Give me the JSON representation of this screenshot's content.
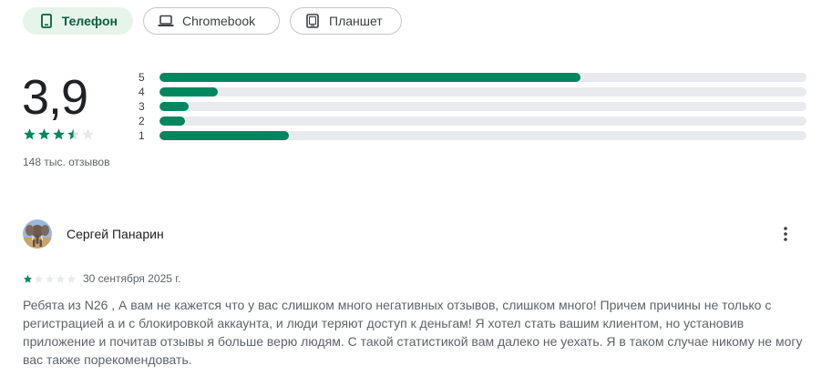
{
  "device_tabs": [
    {
      "label": "Телефон",
      "icon": "phone-icon",
      "active": true
    },
    {
      "label": "Chromebook",
      "icon": "laptop-icon",
      "active": false
    },
    {
      "label": "Планшет",
      "icon": "tablet-icon",
      "active": false
    }
  ],
  "summary": {
    "rating": "3,9",
    "stars": 3.5,
    "reviews_count": "148 тыс. отзывов"
  },
  "histogram": [
    {
      "label": "5",
      "fraction": 0.65
    },
    {
      "label": "4",
      "fraction": 0.09
    },
    {
      "label": "3",
      "fraction": 0.045
    },
    {
      "label": "2",
      "fraction": 0.04
    },
    {
      "label": "1",
      "fraction": 0.2
    }
  ],
  "review": {
    "author": "Сергей Панарин",
    "avatar_icon": "elephant-avatar",
    "stars": 1,
    "date": "30 сентября 2025 г.",
    "text": "Ребята из N26 , А вам не кажется что у вас слишком много негативных отзывов, слишком много! Причем причины не только с регистрацией а и с блокировкой аккаунта, и люди теряют доступ к деньгам! Я хотел стать вашим клиентом, но установив приложение и почитав отзывы я больше верю людям. С такой статистикой вам далеко не уехать. Я в таком случае никому не могу вас также порекомендовать."
  },
  "colors": {
    "accent": "#01875f",
    "active_chip_bg": "#e6f4ea",
    "track": "#e8eaed",
    "empty_star": "#dadce0"
  }
}
